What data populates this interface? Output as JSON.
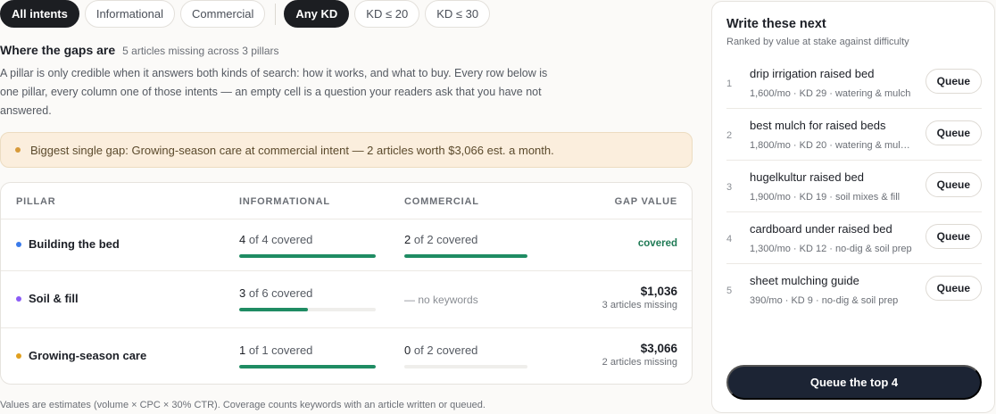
{
  "filters": {
    "intent": [
      "All intents",
      "Informational",
      "Commercial"
    ],
    "kd": [
      "Any KD",
      "KD ≤ 20",
      "KD ≤ 30"
    ]
  },
  "gaps": {
    "title": "Where the gaps are",
    "subtitle": "5 articles missing across 3 pillars",
    "intro": "A pillar is only credible when it answers both kinds of search: how it works, and what to buy. Every row below is one pillar, every column one of those intents — an empty cell is a question your readers ask that you have not answered."
  },
  "callout": {
    "text": "Biggest single gap: Growing-season care at commercial intent — 2 articles worth $3,066 est. a month.",
    "accent": "#d79a3a"
  },
  "table": {
    "headers": {
      "pillar": "PILLAR",
      "informational": "INFORMATIONAL",
      "commercial": "COMMERCIAL",
      "gap": "GAP VALUE"
    },
    "rows": [
      {
        "pillar": "Building the bed",
        "dot": "#3b7bea",
        "info": {
          "done": "4",
          "rest": "of 4 covered",
          "progress": 1.0
        },
        "comm": {
          "done": "2",
          "rest": "of 2 covered",
          "progress": 1.0,
          "text": ""
        },
        "gap": {
          "amount": "",
          "missing": "",
          "tag": "covered"
        }
      },
      {
        "pillar": "Soil & fill",
        "dot": "#8b5cf6",
        "info": {
          "done": "3",
          "rest": "of 6 covered",
          "progress": 0.5
        },
        "comm": {
          "done": "",
          "rest": "",
          "progress": null,
          "text": "— no keywords"
        },
        "gap": {
          "amount": "$1,036",
          "missing": "3 articles missing",
          "tag": ""
        }
      },
      {
        "pillar": "Growing-season care",
        "dot": "#e0a020",
        "info": {
          "done": "1",
          "rest": "of 1 covered",
          "progress": 1.0
        },
        "comm": {
          "done": "0",
          "rest": "of 2 covered",
          "progress": 0.0,
          "text": ""
        },
        "gap": {
          "amount": "$3,066",
          "missing": "2 articles missing",
          "tag": ""
        }
      }
    ]
  },
  "footnote": "Values are estimates (volume × CPC × 30% CTR). Coverage counts keywords with an article written or queued.",
  "panel": {
    "title": "Write these next",
    "subtitle": "Ranked by value at stake against difficulty",
    "items": [
      {
        "num": "1",
        "keyword": "drip irrigation raised bed",
        "meta": "1,600/mo · KD 29 · watering & mulch",
        "button": "Queue"
      },
      {
        "num": "2",
        "keyword": "best mulch for raised beds",
        "meta": "1,800/mo · KD 20 · watering & mul…",
        "button": "Queue"
      },
      {
        "num": "3",
        "keyword": "hugelkultur raised bed",
        "meta": "1,900/mo · KD 19 · soil mixes & fill",
        "button": "Queue"
      },
      {
        "num": "4",
        "keyword": "cardboard under raised bed",
        "meta": "1,300/mo · KD 12 · no-dig & soil prep",
        "button": "Queue"
      },
      {
        "num": "5",
        "keyword": "sheet mulching guide",
        "meta": "390/mo · KD 9 · no-dig & soil prep",
        "button": "Queue"
      }
    ],
    "cta": "Queue the top 4"
  },
  "colors": {
    "progress": "#1f8c63",
    "dark": "#1c1e22",
    "cta": "#1c2434"
  }
}
